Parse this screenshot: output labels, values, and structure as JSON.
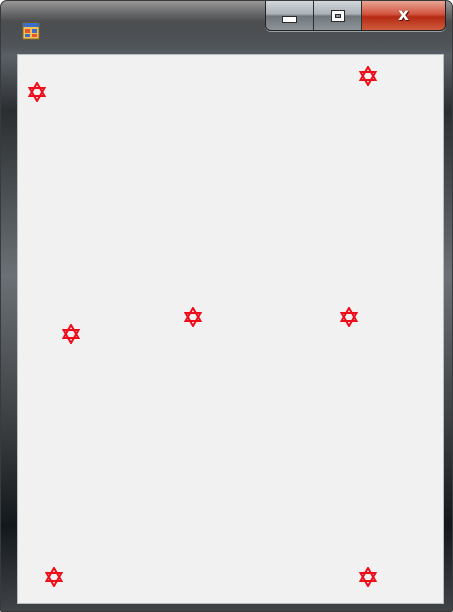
{
  "window": {
    "title": "",
    "app_icon": "windows-form-icon"
  },
  "caption_buttons": {
    "minimize_icon": "minimize-icon",
    "maximize_icon": "maximize-icon",
    "close_glyph": "x"
  },
  "colors": {
    "star": "#ee0d1a",
    "client_background": "#f1f1f1",
    "close_button": "#c43720"
  },
  "canvas": {
    "shape_icon": "six-pointed-star-icon",
    "shape_count": 7
  }
}
